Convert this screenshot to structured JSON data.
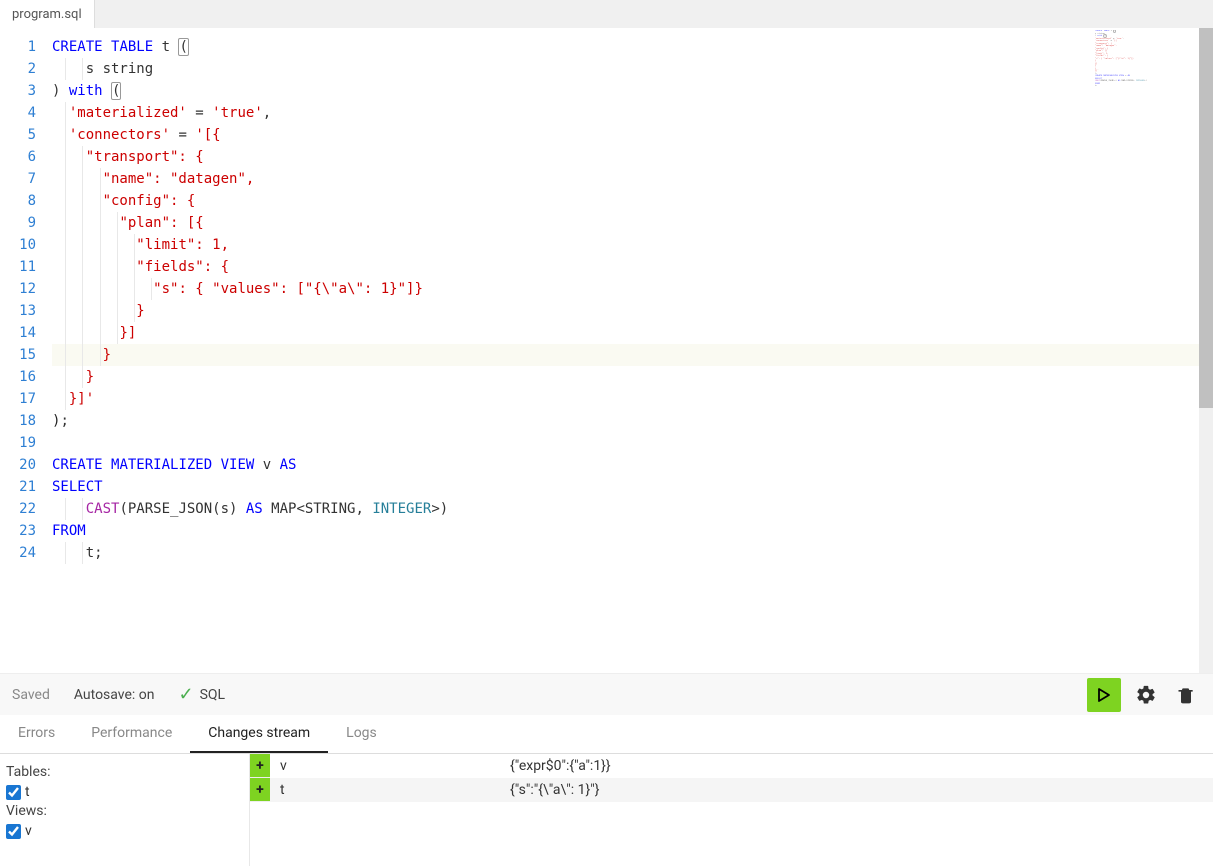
{
  "tab": {
    "filename": "program.sql"
  },
  "editor": {
    "line_count": 24,
    "current_line": 15,
    "lines": [
      {
        "html": "<span class='kw'>CREATE</span> <span class='kw'>TABLE</span> t <span class='paren-highlight'>(</span>"
      },
      {
        "html": "    s string"
      },
      {
        "html": ") <span class='kw'>with</span> <span class='paren-highlight'>(</span>"
      },
      {
        "html": "  <span class='str'>'materialized'</span> = <span class='str'>'true'</span>,"
      },
      {
        "html": "  <span class='str'>'connectors'</span> = <span class='str'>'[{</span>"
      },
      {
        "html": "    <span class='str'>\"transport\": {</span>"
      },
      {
        "html": "      <span class='str'>\"name\": \"datagen\",</span>"
      },
      {
        "html": "      <span class='str'>\"config\": {</span>"
      },
      {
        "html": "        <span class='str'>\"plan\": [{</span>"
      },
      {
        "html": "          <span class='str'>\"limit\": 1,</span>"
      },
      {
        "html": "          <span class='str'>\"fields\": {</span>"
      },
      {
        "html": "            <span class='str'>\"s\": { \"values\": [\"{\\\"a\\\": 1}\"]}</span>"
      },
      {
        "html": "          <span class='str'>}</span>"
      },
      {
        "html": "        <span class='str'>}]</span>"
      },
      {
        "html": "      <span class='str'>}</span>"
      },
      {
        "html": "    <span class='str'>}</span>"
      },
      {
        "html": "  <span class='str'>}]'</span>"
      },
      {
        "html": "<span class='punct'>)</span>;"
      },
      {
        "html": ""
      },
      {
        "html": "<span class='kw'>CREATE</span> <span class='kw'>MATERIALIZED</span> <span class='kw'>VIEW</span> v <span class='kw'>AS</span>"
      },
      {
        "html": "<span class='kw'>SELECT</span>"
      },
      {
        "html": "    <span class='fn'>CAST</span>(PARSE_JSON(s) <span class='kw'>AS</span> MAP&lt;STRING, <span class='typ'>INTEGER</span>&gt;)"
      },
      {
        "html": "<span class='kw'>FROM</span>"
      },
      {
        "html": "    t;"
      }
    ]
  },
  "status": {
    "saved": "Saved",
    "autosave": "Autosave: on",
    "language": "SQL"
  },
  "panel_tabs": {
    "errors": "Errors",
    "performance": "Performance",
    "changes": "Changes stream",
    "logs": "Logs",
    "active": "changes"
  },
  "side": {
    "tables_label": "Tables:",
    "views_label": "Views:",
    "tables": [
      {
        "name": "t",
        "checked": true
      }
    ],
    "views": [
      {
        "name": "v",
        "checked": true
      }
    ]
  },
  "changes": [
    {
      "op": "+",
      "name": "v",
      "data": "{\"expr$0\":{\"a\":1}}"
    },
    {
      "op": "+",
      "name": "t",
      "data": "{\"s\":\"{\\\"a\\\": 1}\"}"
    }
  ]
}
